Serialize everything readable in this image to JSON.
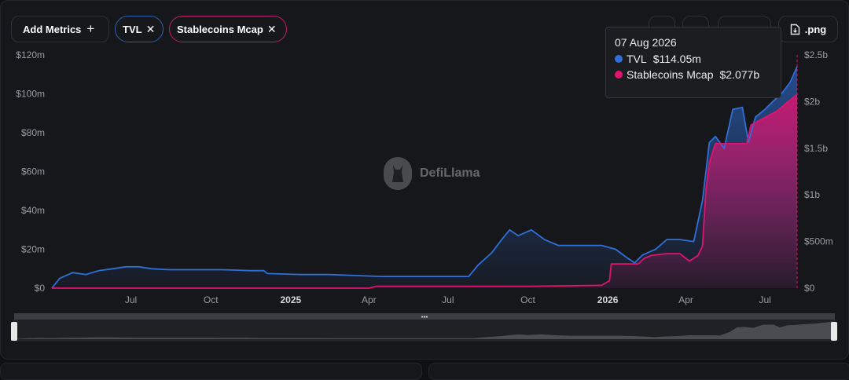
{
  "toolbar": {
    "add_metrics_label": "Add Metrics",
    "chips": [
      {
        "label": "TVL",
        "color": "#2f6fd8"
      },
      {
        "label": "Stablecoins Mcap",
        "color": "#e0136f"
      }
    ],
    "png_label": ".png"
  },
  "watermark": {
    "text": "DefiLlama"
  },
  "tooltip": {
    "date": "07 Aug 2026",
    "rows": [
      {
        "name": "TVL",
        "value": "$114.05m",
        "color": "#2f6fd8"
      },
      {
        "name": "Stablecoins Mcap",
        "value": "$2.077b",
        "color": "#e0136f"
      }
    ]
  },
  "chart_data": {
    "type": "line",
    "x_range": [
      "2024-04-01",
      "2026-08-07"
    ],
    "x_ticks": [
      {
        "date": "2024-07-01",
        "label": "Jul",
        "year": false
      },
      {
        "date": "2024-10-01",
        "label": "Oct",
        "year": false
      },
      {
        "date": "2025-01-01",
        "label": "2025",
        "year": true
      },
      {
        "date": "2025-04-01",
        "label": "Apr",
        "year": false
      },
      {
        "date": "2025-07-01",
        "label": "Jul",
        "year": false
      },
      {
        "date": "2025-10-01",
        "label": "Oct",
        "year": false
      },
      {
        "date": "2026-01-01",
        "label": "2026",
        "year": true
      },
      {
        "date": "2026-04-01",
        "label": "Apr",
        "year": false
      },
      {
        "date": "2026-07-01",
        "label": "Jul",
        "year": false
      }
    ],
    "y_left": {
      "min": 0,
      "max": 120,
      "ticks": [
        0,
        20,
        40,
        60,
        80,
        100,
        120
      ],
      "tick_labels": [
        "$0",
        "$20m",
        "$40m",
        "$60m",
        "$80m",
        "$100m",
        "$120m"
      ]
    },
    "y_right": {
      "min": 0,
      "max": 2.5,
      "ticks": [
        0,
        0.5,
        1,
        1.5,
        2,
        2.5
      ],
      "tick_labels": [
        "$0",
        "$500m",
        "$1b",
        "$1.5b",
        "$2b",
        "$2.5b"
      ]
    },
    "series": [
      {
        "name": "TVL",
        "axis": "left",
        "unit": "$m",
        "color": "#2f6fd8",
        "points": [
          [
            "2024-04-01",
            0
          ],
          [
            "2024-04-10",
            5
          ],
          [
            "2024-04-25",
            8
          ],
          [
            "2024-05-10",
            7
          ],
          [
            "2024-05-25",
            9
          ],
          [
            "2024-06-10",
            10
          ],
          [
            "2024-06-25",
            11
          ],
          [
            "2024-07-10",
            11
          ],
          [
            "2024-07-25",
            10
          ],
          [
            "2024-08-15",
            9.5
          ],
          [
            "2024-09-15",
            9.5
          ],
          [
            "2024-10-15",
            9.5
          ],
          [
            "2024-11-15",
            9
          ],
          [
            "2024-12-01",
            9
          ],
          [
            "2024-12-05",
            7.5
          ],
          [
            "2025-01-15",
            7
          ],
          [
            "2025-02-15",
            7
          ],
          [
            "2025-03-15",
            6.5
          ],
          [
            "2025-04-15",
            6
          ],
          [
            "2025-05-15",
            6
          ],
          [
            "2025-06-15",
            6
          ],
          [
            "2025-07-10",
            6
          ],
          [
            "2025-07-25",
            6
          ],
          [
            "2025-08-05",
            12
          ],
          [
            "2025-08-20",
            18
          ],
          [
            "2025-09-01",
            25
          ],
          [
            "2025-09-10",
            30
          ],
          [
            "2025-09-20",
            27
          ],
          [
            "2025-10-05",
            30
          ],
          [
            "2025-10-20",
            25
          ],
          [
            "2025-11-05",
            22
          ],
          [
            "2025-11-20",
            22
          ],
          [
            "2025-12-10",
            22
          ],
          [
            "2025-12-25",
            22
          ],
          [
            "2026-01-10",
            20
          ],
          [
            "2026-01-22",
            16
          ],
          [
            "2026-02-01",
            13
          ],
          [
            "2026-02-10",
            17
          ],
          [
            "2026-02-25",
            20
          ],
          [
            "2026-03-10",
            25
          ],
          [
            "2026-03-25",
            25
          ],
          [
            "2026-04-10",
            24
          ],
          [
            "2026-04-20",
            45
          ],
          [
            "2026-04-28",
            75
          ],
          [
            "2026-05-05",
            78
          ],
          [
            "2026-05-15",
            72
          ],
          [
            "2026-05-25",
            92
          ],
          [
            "2026-06-05",
            93
          ],
          [
            "2026-06-12",
            75
          ],
          [
            "2026-06-20",
            88
          ],
          [
            "2026-07-01",
            92
          ],
          [
            "2026-07-10",
            96
          ],
          [
            "2026-07-20",
            100
          ],
          [
            "2026-07-30",
            106
          ],
          [
            "2026-08-07",
            114.05
          ]
        ]
      },
      {
        "name": "Stablecoins Mcap",
        "axis": "right",
        "unit": "$b",
        "color": "#e0136f",
        "points": [
          [
            "2024-04-01",
            0
          ],
          [
            "2025-04-01",
            0
          ],
          [
            "2025-04-10",
            0.02
          ],
          [
            "2025-07-01",
            0.02
          ],
          [
            "2025-10-01",
            0.02
          ],
          [
            "2025-12-25",
            0.03
          ],
          [
            "2026-01-03",
            0.08
          ],
          [
            "2026-01-05",
            0.26
          ],
          [
            "2026-02-05",
            0.26
          ],
          [
            "2026-02-12",
            0.32
          ],
          [
            "2026-02-20",
            0.35
          ],
          [
            "2026-03-10",
            0.37
          ],
          [
            "2026-03-25",
            0.37
          ],
          [
            "2026-04-05",
            0.29
          ],
          [
            "2026-04-15",
            0.35
          ],
          [
            "2026-04-20",
            0.45
          ],
          [
            "2026-04-24",
            1.05
          ],
          [
            "2026-04-28",
            1.35
          ],
          [
            "2026-05-05",
            1.55
          ],
          [
            "2026-05-25",
            1.55
          ],
          [
            "2026-06-10",
            1.55
          ],
          [
            "2026-06-15",
            1.75
          ],
          [
            "2026-06-25",
            1.8
          ],
          [
            "2026-07-05",
            1.85
          ],
          [
            "2026-07-15",
            1.9
          ],
          [
            "2026-07-25",
            1.98
          ],
          [
            "2026-08-07",
            2.077
          ]
        ]
      }
    ]
  }
}
